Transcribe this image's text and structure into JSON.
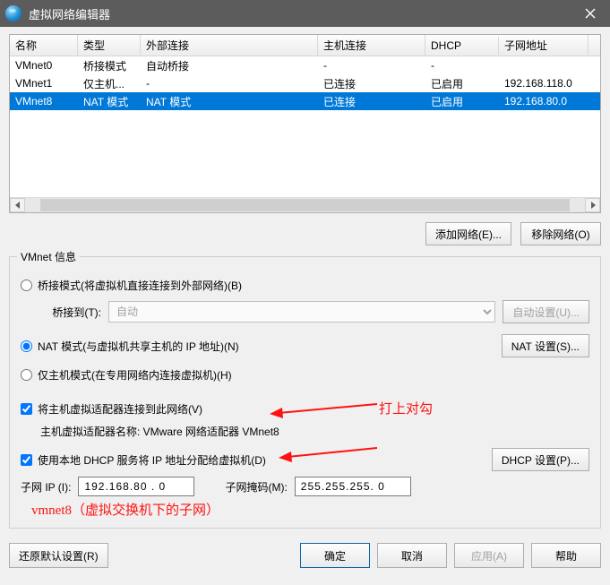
{
  "window": {
    "title": "虚拟网络编辑器"
  },
  "table": {
    "headers": [
      "名称",
      "类型",
      "外部连接",
      "主机连接",
      "DHCP",
      "子网地址"
    ],
    "rows": [
      {
        "name": "VMnet0",
        "type": "桥接模式",
        "ext": "自动桥接",
        "host": "-",
        "dhcp": "-",
        "subnet": "",
        "selected": false
      },
      {
        "name": "VMnet1",
        "type": "仅主机...",
        "ext": "-",
        "host": "已连接",
        "dhcp": "已启用",
        "subnet": "192.168.118.0",
        "selected": false
      },
      {
        "name": "VMnet8",
        "type": "NAT 模式",
        "ext": "NAT 模式",
        "host": "已连接",
        "dhcp": "已启用",
        "subnet": "192.168.80.0",
        "selected": true
      }
    ]
  },
  "buttons": {
    "add_net": "添加网络(E)...",
    "remove_net": "移除网络(O)",
    "auto_set": "自动设置(U)...",
    "nat_set": "NAT 设置(S)...",
    "dhcp_set": "DHCP 设置(P)...",
    "restore": "还原默认设置(R)",
    "ok": "确定",
    "cancel": "取消",
    "apply": "应用(A)",
    "help": "帮助"
  },
  "group": {
    "legend": "VMnet 信息",
    "bridge_radio": "桥接模式(将虚拟机直接连接到外部网络)(B)",
    "bridge_to_label": "桥接到(T):",
    "bridge_to_value": "自动",
    "nat_radio": "NAT 模式(与虚拟机共享主机的 IP 地址)(N)",
    "hostonly_radio": "仅主机模式(在专用网络内连接虚拟机)(H)",
    "hostadapter_check": "将主机虚拟适配器连接到此网络(V)",
    "hostadapter_name": "主机虚拟适配器名称: VMware 网络适配器 VMnet8",
    "dhcp_check": "使用本地 DHCP 服务将 IP 地址分配给虚拟机(D)",
    "subnet_ip_label": "子网 IP (I):",
    "subnet_ip_value": "192.168.80 . 0",
    "subnet_mask_label": "子网掩码(M):",
    "subnet_mask_value": "255.255.255. 0"
  },
  "annotation": {
    "check_hint": "打上对勾",
    "bottom": "vmnet8（虚拟交换机下的子网）"
  }
}
